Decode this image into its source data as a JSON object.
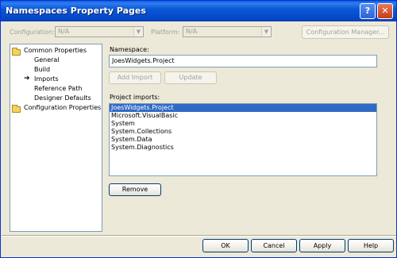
{
  "window": {
    "title": "Namespaces Property Pages"
  },
  "title_buttons": {
    "help": "?",
    "close": "✕"
  },
  "toolbar": {
    "configuration_label": "Configuration:",
    "configuration_value": "N/A",
    "platform_label": "Platform:",
    "platform_value": "N/A",
    "config_manager_label": "Configuration Manager..."
  },
  "tree": {
    "items": [
      {
        "label": "Common Properties"
      },
      {
        "label": "General"
      },
      {
        "label": "Build"
      },
      {
        "label": "Imports"
      },
      {
        "label": "Reference Path"
      },
      {
        "label": "Designer Defaults"
      },
      {
        "label": "Configuration Properties"
      }
    ]
  },
  "namespace": {
    "label": "Namespace:",
    "value": "JoesWidgets.Project",
    "add_import_label": "Add Import",
    "update_label": "Update"
  },
  "imports": {
    "label": "Project imports:",
    "items": [
      "JoesWidgets.Project",
      "Microsoft.VisualBasic",
      "System",
      "System.Collections",
      "System.Data",
      "System.Diagnostics"
    ],
    "selected_index": 0,
    "remove_label": "Remove"
  },
  "footer": {
    "ok_label": "OK",
    "cancel_label": "Cancel",
    "apply_label": "Apply",
    "help_label": "Help"
  },
  "colors": {
    "titlebar": "#0a58d6",
    "dialog_bg": "#ece9d8",
    "selection": "#316ac5",
    "field_border": "#7f9db9"
  }
}
